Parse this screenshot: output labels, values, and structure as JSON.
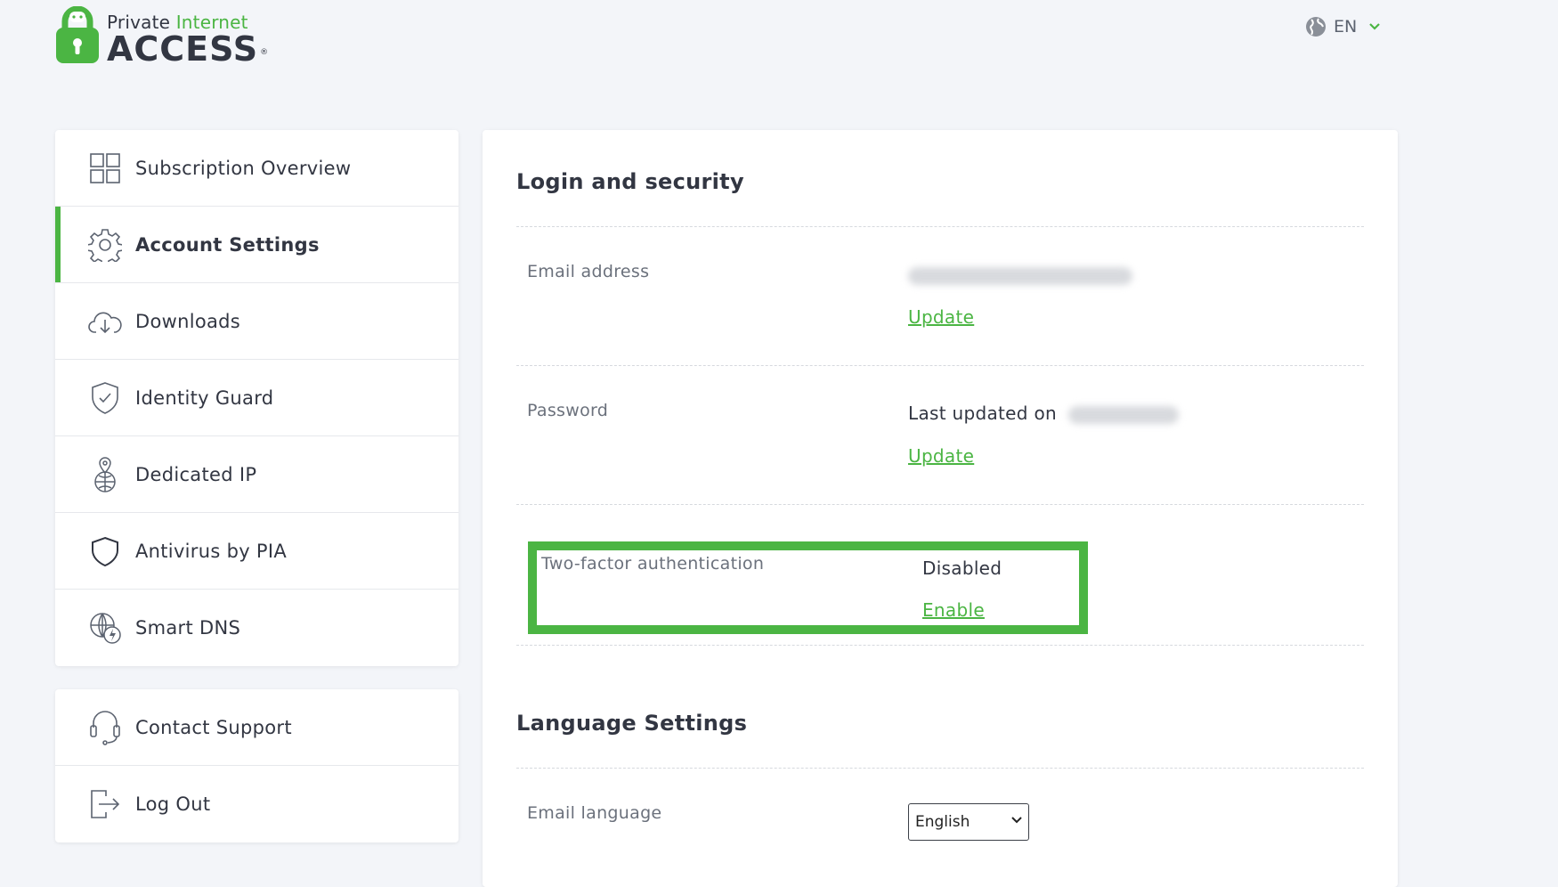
{
  "logo": {
    "line1_a": "Private",
    "line1_b": "Internet",
    "line2": "ACCESS",
    "reg": "®"
  },
  "language_switch": {
    "code": "EN",
    "icon": "globe-icon"
  },
  "colors": {
    "accent": "#4bb543",
    "text": "#323642",
    "muted": "#6b717c",
    "background": "#f3f5f9"
  },
  "sidebar": {
    "items": [
      {
        "label": "Subscription Overview",
        "icon": "grid-icon"
      },
      {
        "label": "Account Settings",
        "icon": "gear-icon",
        "active": true
      },
      {
        "label": "Downloads",
        "icon": "cloud-download-icon"
      },
      {
        "label": "Identity Guard",
        "icon": "shield-check-icon"
      },
      {
        "label": "Dedicated IP",
        "icon": "globe-pin-icon"
      },
      {
        "label": "Antivirus by PIA",
        "icon": "shield-icon"
      },
      {
        "label": "Smart DNS",
        "icon": "globe-bolt-icon"
      }
    ],
    "secondary": [
      {
        "label": "Contact Support",
        "icon": "headset-icon"
      },
      {
        "label": "Log Out",
        "icon": "logout-icon"
      }
    ]
  },
  "main": {
    "login_security": {
      "title": "Login and security",
      "email": {
        "label": "Email address",
        "update": "Update"
      },
      "password": {
        "label": "Password",
        "value_prefix": "Last updated on",
        "update": "Update"
      },
      "two_factor": {
        "label": "Two-factor authentication",
        "status": "Disabled",
        "action": "Enable"
      }
    },
    "language_settings": {
      "title": "Language Settings",
      "email_language": {
        "label": "Email language",
        "selected": "English"
      }
    }
  }
}
